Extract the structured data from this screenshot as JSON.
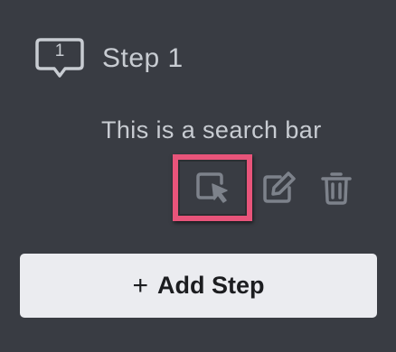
{
  "step": {
    "number": "1",
    "title": "Step 1",
    "description": "This is a search bar"
  },
  "actions": {
    "select_icon": "select-element-icon",
    "edit_icon": "edit-icon",
    "delete_icon": "trash-icon"
  },
  "add_button": {
    "plus": "+",
    "label": "Add Step"
  },
  "colors": {
    "background": "#393c43",
    "text": "#c8ccd2",
    "icon": "#7d828b",
    "highlight": "#e8547a",
    "button_bg": "#ebecf0"
  }
}
